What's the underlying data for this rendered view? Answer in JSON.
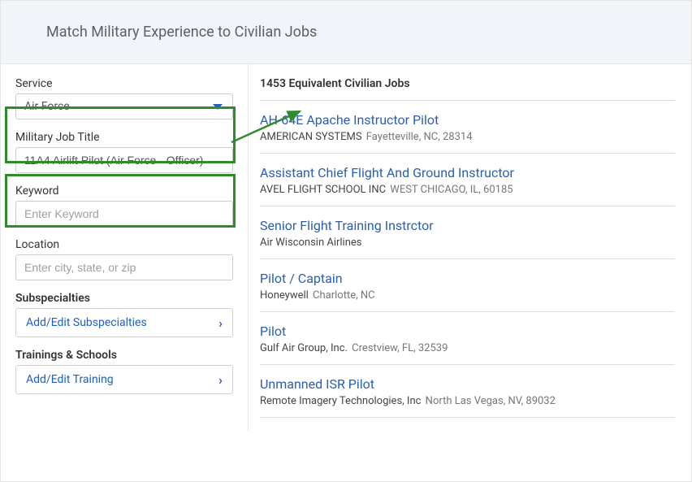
{
  "header": {
    "title": "Match Military Experience to Civilian Jobs"
  },
  "sidebar": {
    "service": {
      "label": "Service",
      "value": "Air Force"
    },
    "jobTitle": {
      "label": "Military Job Title",
      "value": "11A4 Airlift Pilot (Air Force - Officer)"
    },
    "keyword": {
      "label": "Keyword",
      "placeholder": "Enter Keyword",
      "value": ""
    },
    "location": {
      "label": "Location",
      "placeholder": "Enter city, state, or zip",
      "value": ""
    },
    "subspecialties": {
      "label": "Subspecialties",
      "button": "Add/Edit Subspecialties"
    },
    "trainings": {
      "label": "Trainings & Schools",
      "button": "Add/Edit Training"
    }
  },
  "results": {
    "headerText": "1453 Equivalent Civilian Jobs",
    "jobs": [
      {
        "title": "AH-64E Apache Instructor Pilot",
        "company": "AMERICAN SYSTEMS",
        "location": "Fayetteville, NC, 28314"
      },
      {
        "title": "Assistant Chief Flight And Ground Instructor",
        "company": "AVEL FLIGHT SCHOOL INC",
        "location": "WEST CHICAGO, IL, 60185"
      },
      {
        "title": "Senior Flight Training Instrctor",
        "company": "Air Wisconsin Airlines",
        "location": ""
      },
      {
        "title": "Pilot / Captain",
        "company": "Honeywell",
        "location": "Charlotte, NC"
      },
      {
        "title": "Pilot",
        "company": "Gulf Air Group, Inc.",
        "location": "Crestview, FL, 32539"
      },
      {
        "title": "Unmanned ISR Pilot",
        "company": "Remote Imagery Technologies, Inc",
        "location": "North Las Vegas, NV, 89032"
      }
    ]
  },
  "colors": {
    "link": "#2b5fb0",
    "highlight": "#2e8b2e"
  }
}
